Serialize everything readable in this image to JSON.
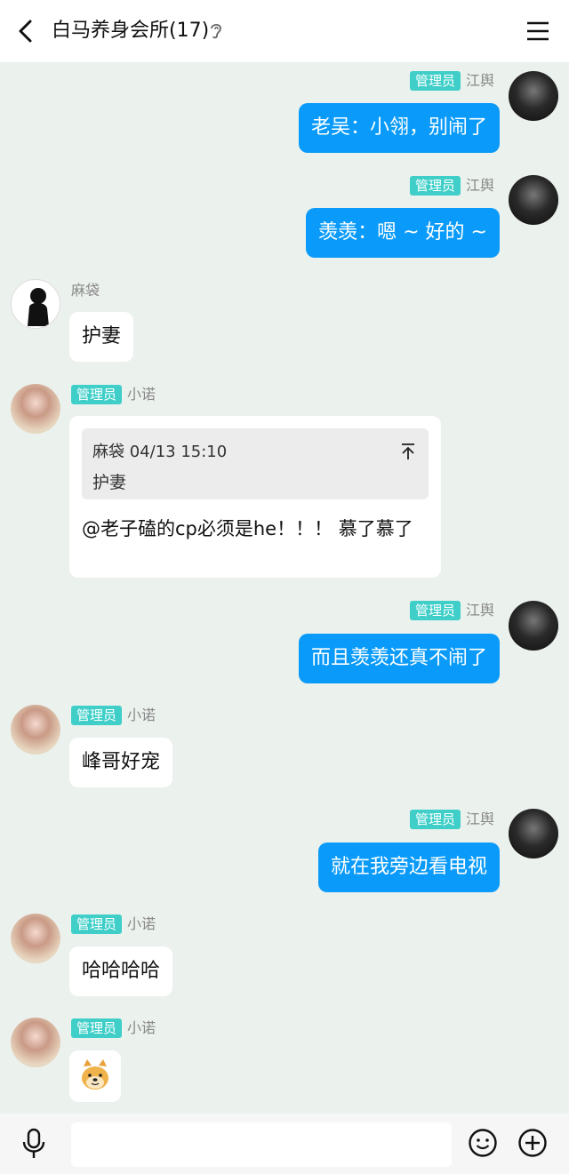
{
  "header": {
    "title": "白马养身会所(17)",
    "back_icon": "chevron-left-icon",
    "ear_icon": "ear-icon",
    "menu_icon": "hamburger-menu-icon"
  },
  "messages": [
    {
      "side": "out",
      "badge": "管理员",
      "nick": "江舆",
      "text": "老吴：小翎，别闹了"
    },
    {
      "side": "out",
      "badge": "管理员",
      "nick": "江舆",
      "text": "羡羡：嗯 ~ 好的 ~"
    },
    {
      "side": "in",
      "badge": "",
      "nick": "麻袋",
      "text": "护妻"
    },
    {
      "side": "in",
      "badge": "管理员",
      "nick": "小诺",
      "quote_header": "麻袋 04/13 15:10",
      "quote_text": "护妻",
      "text": "@老子磕的cp必须是he！！！ 慕了慕了"
    },
    {
      "side": "out",
      "badge": "管理员",
      "nick": "江舆",
      "text": "而且羡羡还真不闹了"
    },
    {
      "side": "in",
      "badge": "管理员",
      "nick": "小诺",
      "text": "峰哥好宠"
    },
    {
      "side": "out",
      "badge": "管理员",
      "nick": "江舆",
      "text": "就在我旁边看电视"
    },
    {
      "side": "in",
      "badge": "管理员",
      "nick": "小诺",
      "text": "哈哈哈哈"
    },
    {
      "side": "in",
      "badge": "管理员",
      "nick": "小诺",
      "sticker": "doge-sticker"
    }
  ],
  "input_bar": {
    "mic_icon": "microphone-icon",
    "input_value": "",
    "emoji_icon": "smiley-icon",
    "plus_icon": "plus-circle-icon"
  },
  "colors": {
    "background": "#ebf1ed",
    "outgoing_bubble": "#0a9bfa",
    "admin_badge": "#3fcfc8"
  }
}
